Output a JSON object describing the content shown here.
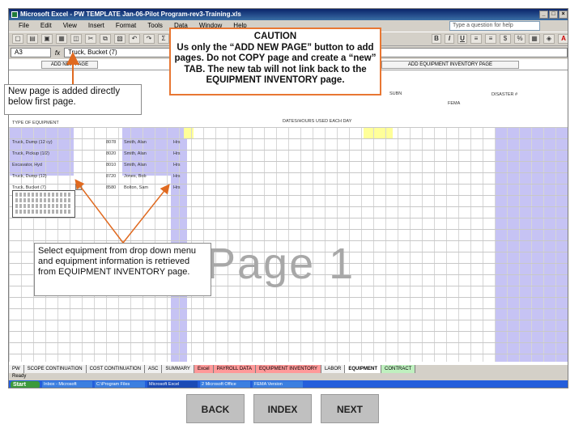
{
  "window": {
    "title": "Microsoft Excel - PW TEMPLATE Jan-06-Pilot Program-rev3-Training.xls",
    "menus": [
      "File",
      "Edit",
      "View",
      "Insert",
      "Format",
      "Tools",
      "Data",
      "Window",
      "Help"
    ],
    "ask_placeholder": "Type a question for help",
    "name_box": "A3",
    "formula": "Truck, Bucket (7)"
  },
  "sheet": {
    "add_button": "ADD NEW PAGE",
    "equipment_button": "ADD EQUIPMENT INVENTORY PAGE",
    "watermark": "Page  1",
    "section_header": "TYPE OF EQUIPMENT",
    "hours_header": "DATES/HOURS USED EACH DAY",
    "fema_label": "FEMA",
    "disaster_label": "DISASTER #",
    "rows": [
      {
        "item": "Truck, Dump (12 cy)",
        "code": "8078",
        "op": "Smith, Alan",
        "unit": "Hrs"
      },
      {
        "item": "Truck, Pickup (1/2)",
        "code": "8020",
        "op": "Smith, Alan",
        "unit": "Hrs"
      },
      {
        "item": "Excavator, Hyd",
        "code": "8010",
        "op": "Smith, Alan",
        "unit": "Hrs"
      },
      {
        "item": "Truck, Dump (12)",
        "code": "8720",
        "op": "Jones, Bob",
        "unit": "Hrs"
      },
      {
        "item": "Truck, Bucket (7)",
        "code": "8580",
        "op": "Bolton, Sam",
        "unit": "Hrs"
      }
    ]
  },
  "sheet_tabs": [
    "PW",
    "SCOPE CONTINUATION",
    "COST CONTINUATION",
    "ASC",
    "SUMMARY",
    "Excel",
    "PAYROLL DATA",
    "EQUIPMENT INVENTORY",
    "LABOR",
    "EQUIPMENT",
    "CONTRACT"
  ],
  "status": "Ready",
  "taskbar": {
    "start": "Start",
    "tasks": [
      "Inbox - Microsoft",
      "C:\\Program Files",
      "Microsoft Excel",
      "2 Microsoft Office",
      "FEMA Version"
    ]
  },
  "callouts": {
    "caution": "CAUTION\nUs only the “ADD NEW PAGE” button to add pages. Do not COPY page and create a “new” TAB. The new tab will not link back to the EQUIPMENT INVENTORY page.",
    "caution_title": "CAUTION",
    "caution_body": "Us only the “ADD NEW PAGE” button to add pages. Do not COPY page and create a “new” TAB. The new tab will not link back to the EQUIPMENT INVENTORY page.",
    "new_page": "New page is added directly below first page.",
    "select": "Select equipment from drop down menu and equipment information is retrieved from EQUIPMENT INVENTORY page."
  },
  "nav": {
    "back": "BACK",
    "index": "INDEX",
    "next": "NEXT"
  },
  "colors": {
    "caution_border": "#e87733",
    "arrow": "#e06a20"
  }
}
